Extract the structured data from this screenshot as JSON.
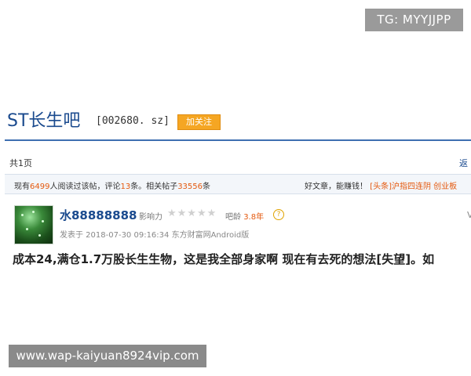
{
  "tg_badge": "TG: MYYJJPP",
  "header": {
    "bar_title": "ST长生吧",
    "stock_code": "[002680. sz]",
    "follow_label": "加关注"
  },
  "nav": {
    "total_pages": "共1页",
    "back_label": "返"
  },
  "stats": {
    "prefix": "现有",
    "readers": "6499",
    "readers_suffix": "人阅读过该帖，评论",
    "comments": "13",
    "comments_suffix": "条。相关帖子",
    "related": "33556",
    "related_suffix": "条",
    "promo_text": "好文章，能赚钱！",
    "promo_link": "[头条]沪指四连阴 创业板"
  },
  "post": {
    "username": "水88888888",
    "influence_label": "影响力",
    "stars": "★★★★★",
    "age_label": "吧龄",
    "age_value": "3.8年",
    "help_icon": "?",
    "meta": "发表于 2018-07-30 09:16:34 东方财富网Android版",
    "more": "V",
    "content": "成本24,满仓1.7万股长生生物，这是我全部身家啊 现在有去死的想法[失望]。如"
  },
  "watermark": "www.wap-kaiyuan8924vip.com"
}
